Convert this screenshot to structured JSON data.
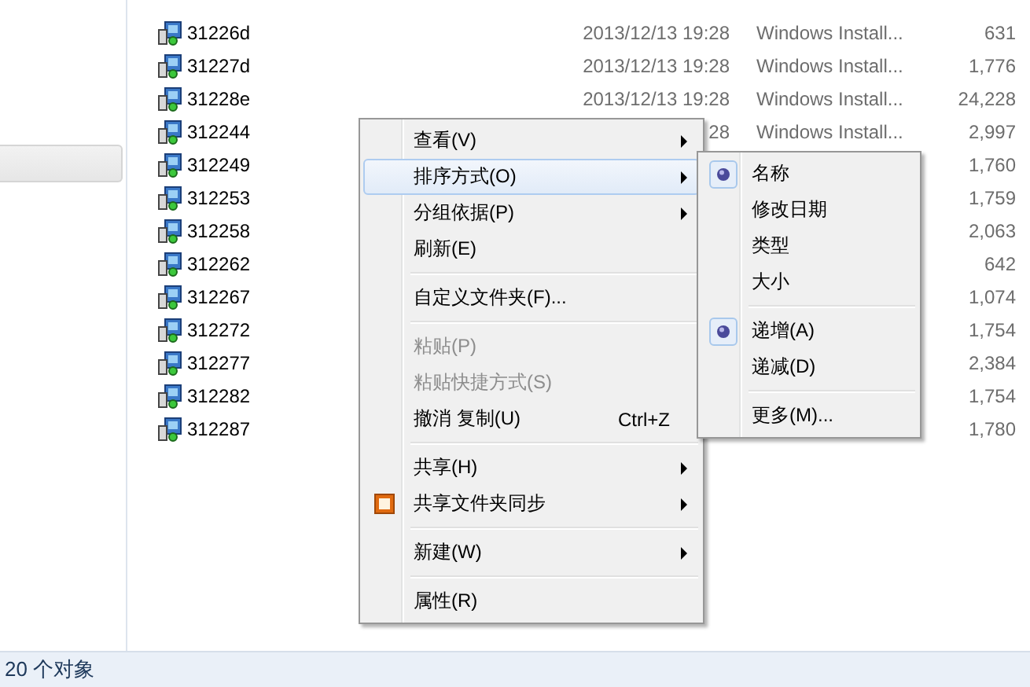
{
  "files": [
    {
      "name": "31226d",
      "modified": "2013/12/13 19:28",
      "type": "Windows Install...",
      "size": "631"
    },
    {
      "name": "31227d",
      "modified": "2013/12/13 19:28",
      "type": "Windows Install...",
      "size": "1,776"
    },
    {
      "name": "31228e",
      "modified": "2013/12/13 19:28",
      "type": "Windows Install...",
      "size": "24,228"
    },
    {
      "name": "312244",
      "modified": "28",
      "type": "Windows Install...",
      "size": "2,997"
    },
    {
      "name": "312249",
      "size": "1,760"
    },
    {
      "name": "312253",
      "size": "1,759"
    },
    {
      "name": "312258",
      "size": "2,063"
    },
    {
      "name": "312262",
      "size": "642"
    },
    {
      "name": "312267",
      "size": "1,074"
    },
    {
      "name": "312272",
      "size": "1,754"
    },
    {
      "name": "312277",
      "size": "2,384"
    },
    {
      "name": "312282",
      "size": "1,754"
    },
    {
      "name": "312287",
      "size": "1,780"
    }
  ],
  "context_menu": [
    {
      "kind": "item",
      "label": "查看(V)",
      "submenu": true,
      "disabled": false,
      "selected": false
    },
    {
      "kind": "item",
      "label": "排序方式(O)",
      "submenu": true,
      "disabled": false,
      "selected": true
    },
    {
      "kind": "item",
      "label": "分组依据(P)",
      "submenu": true,
      "disabled": false,
      "selected": false
    },
    {
      "kind": "item",
      "label": "刷新(E)",
      "submenu": false,
      "disabled": false,
      "selected": false
    },
    {
      "kind": "separator"
    },
    {
      "kind": "item",
      "label": "自定义文件夹(F)...",
      "submenu": false,
      "disabled": false,
      "selected": false
    },
    {
      "kind": "separator"
    },
    {
      "kind": "item",
      "label": "粘贴(P)",
      "submenu": false,
      "disabled": true,
      "selected": false
    },
    {
      "kind": "item",
      "label": "粘贴快捷方式(S)",
      "submenu": false,
      "disabled": true,
      "selected": false
    },
    {
      "kind": "item",
      "label": "撤消 复制(U)",
      "shortcut": "Ctrl+Z",
      "submenu": false,
      "disabled": false,
      "selected": false
    },
    {
      "kind": "separator"
    },
    {
      "kind": "item",
      "label": "共享(H)",
      "submenu": true,
      "disabled": false,
      "selected": false
    },
    {
      "kind": "icon_item",
      "label": "共享文件夹同步",
      "submenu": true,
      "disabled": false,
      "selected": false
    },
    {
      "kind": "separator"
    },
    {
      "kind": "item",
      "label": "新建(W)",
      "submenu": true,
      "disabled": false,
      "selected": false
    },
    {
      "kind": "separator"
    },
    {
      "kind": "item",
      "label": "属性(R)",
      "submenu": false,
      "disabled": false,
      "selected": false
    }
  ],
  "sort_submenu": [
    {
      "kind": "item",
      "label": "名称",
      "checked": true
    },
    {
      "kind": "item",
      "label": "修改日期",
      "checked": false
    },
    {
      "kind": "item",
      "label": "类型",
      "checked": false
    },
    {
      "kind": "item",
      "label": "大小",
      "checked": false
    },
    {
      "kind": "separator"
    },
    {
      "kind": "item",
      "label": "递增(A)",
      "checked": true
    },
    {
      "kind": "item",
      "label": "递减(D)",
      "checked": false
    },
    {
      "kind": "separator"
    },
    {
      "kind": "item",
      "label": "更多(M)...",
      "checked": false
    }
  ],
  "status_bar": {
    "text": "20 个对象"
  }
}
